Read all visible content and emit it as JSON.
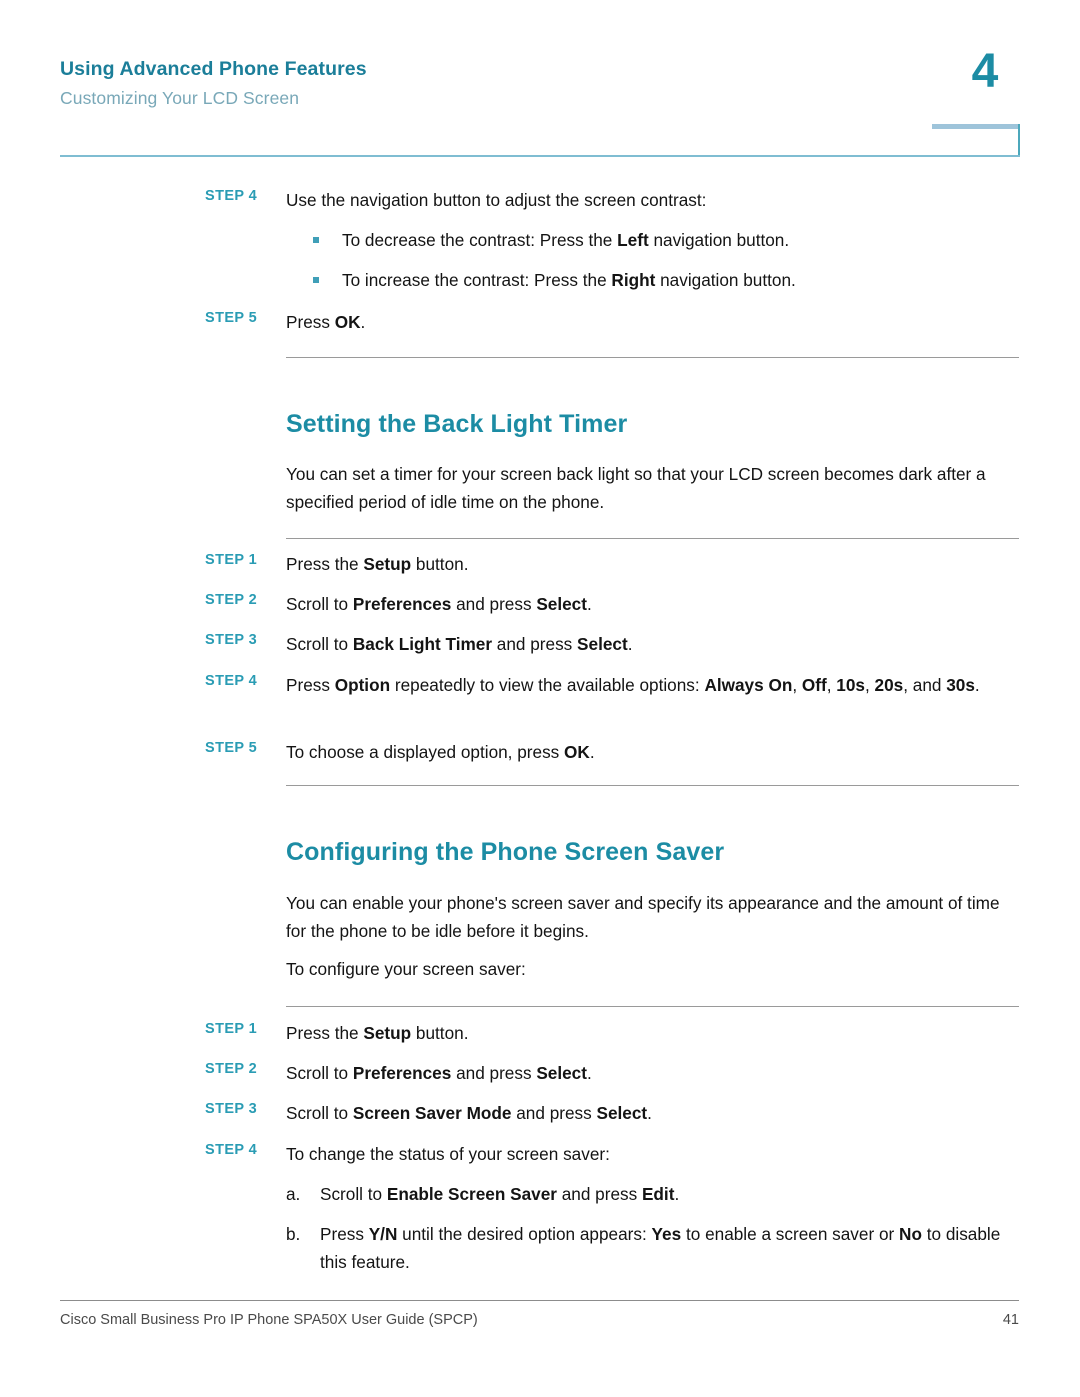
{
  "header": {
    "title": "Using Advanced Phone Features",
    "subtitle": "Customizing Your LCD Screen",
    "chapter_number": "4",
    "accent_color": "#1c8ca4",
    "rule_color": "#7fbdd2"
  },
  "footer": {
    "document_title": "Cisco Small Business Pro IP Phone SPA50X User Guide (SPCP)",
    "page_number": "41"
  },
  "blocks": {
    "contrast_steps": {
      "step4_label": "STEP 4",
      "step4_text": "Use the navigation button to adjust the screen contrast:",
      "bullet1_prefix": "To decrease the contrast: Press the ",
      "bullet1_bold": "Left",
      "bullet1_suffix": " navigation button.",
      "bullet2_prefix": "To increase the contrast: Press the ",
      "bullet2_bold": "Right",
      "bullet2_suffix": " navigation button.",
      "step5_label": "STEP 5",
      "step5_prefix": "Press ",
      "step5_bold": "OK",
      "step5_suffix": "."
    },
    "back_light_timer": {
      "heading": "Setting the Back Light Timer",
      "intro": "You can set a timer for your screen back light so that your LCD screen becomes dark after a specified period of idle time on the phone.",
      "step1_label": "STEP 1",
      "step1_prefix": "Press the ",
      "step1_bold": "Setup",
      "step1_suffix": " button.",
      "step2_label": "STEP 2",
      "step2_prefix": "Scroll to ",
      "step2_bold1": "Preferences",
      "step2_mid": " and press ",
      "step2_bold2": "Select",
      "step2_suffix": ".",
      "step3_label": "STEP 3",
      "step3_prefix": "Scroll to ",
      "step3_bold1": "Back Light Timer",
      "step3_mid": " and press ",
      "step3_bold2": "Select",
      "step3_suffix": ".",
      "step4_label": "STEP 4",
      "step4_prefix": "Press ",
      "step4_bold1": "Option",
      "step4_mid": " repeatedly to view the available options: ",
      "step4_opt1": "Always On",
      "step4_sep1": ", ",
      "step4_opt2": "Off",
      "step4_sep2": ", ",
      "step4_opt3": "10s",
      "step4_sep3": ", ",
      "step4_opt4": "20s",
      "step4_sep4": ", and ",
      "step4_opt5": "30s",
      "step4_suffix": ".",
      "step5_label": "STEP 5",
      "step5_prefix": "To choose a displayed option, press ",
      "step5_bold": "OK",
      "step5_suffix": "."
    },
    "screen_saver": {
      "heading": "Configuring the Phone Screen Saver",
      "intro": "You can enable your phone's screen saver and specify its appearance and the amount of time for the phone to be idle before it begins.",
      "lead_in": "To configure your screen saver:",
      "step1_label": "STEP 1",
      "step1_prefix": "Press the ",
      "step1_bold": "Setup",
      "step1_suffix": " button.",
      "step2_label": "STEP 2",
      "step2_prefix": "Scroll to ",
      "step2_bold1": "Preferences",
      "step2_mid": " and press ",
      "step2_bold2": "Select",
      "step2_suffix": ".",
      "step3_label": "STEP 3",
      "step3_prefix": "Scroll to ",
      "step3_bold1": "Screen Saver Mode",
      "step3_mid": " and press ",
      "step3_bold2": "Select",
      "step3_suffix": ".",
      "step4_label": "STEP 4",
      "step4_text": "To change the status of your screen saver:",
      "sub_a_mark": "a.",
      "sub_a_prefix": "Scroll to ",
      "sub_a_bold1": "Enable Screen Saver",
      "sub_a_mid": " and press ",
      "sub_a_bold2": "Edit",
      "sub_a_suffix": ".",
      "sub_b_mark": "b.",
      "sub_b_prefix": "Press ",
      "sub_b_bold1": "Y/N",
      "sub_b_mid": " until the desired option appears: ",
      "sub_b_bold2": "Yes",
      "sub_b_mid2": " to enable a screen saver or ",
      "sub_b_bold3": "No",
      "sub_b_suffix": " to disable this feature."
    }
  }
}
